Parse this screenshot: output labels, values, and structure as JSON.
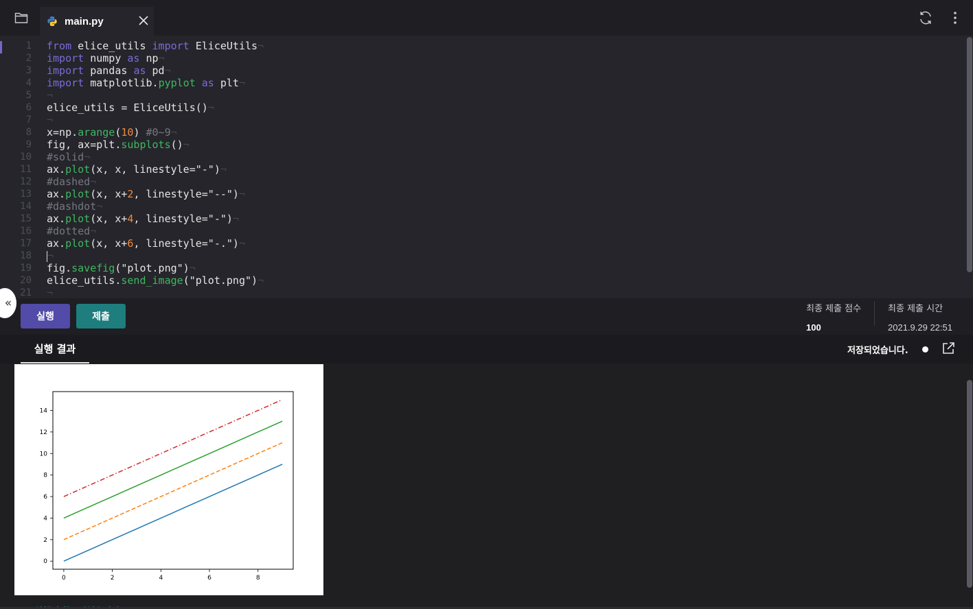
{
  "tabs": {
    "file_name": "main.py"
  },
  "icons": {
    "folder": "folder-icon",
    "python": "python-icon",
    "close": "close-icon",
    "refresh": "refresh-icon",
    "more": "more-vertical-icon",
    "collapse": "double-chevron-left-icon",
    "popout": "external-link-icon"
  },
  "editor": {
    "line_numbers": [
      "1",
      "2",
      "3",
      "4",
      "5",
      "6",
      "7",
      "8",
      "9",
      "10",
      "11",
      "12",
      "13",
      "14",
      "15",
      "16",
      "17",
      "18",
      "19",
      "20",
      "21"
    ],
    "code_lines": [
      "from elice_utils import EliceUtils",
      "import numpy as np",
      "import pandas as pd",
      "import matplotlib.pyplot as plt",
      "",
      "elice_utils = EliceUtils()",
      "",
      "x=np.arange(10) #0~9",
      "fig, ax=plt.subplots()",
      "#solid",
      "ax.plot(x, x, linestyle=\"-\")",
      "#dashed",
      "ax.plot(x, x+2, linestyle=\"--\")",
      "#dashdot",
      "ax.plot(x, x+4, linestyle=\"-\")",
      "#dotted",
      "ax.plot(x, x+6, linestyle=\"-.\")",
      "",
      "fig.savefig(\"plot.png\")",
      "elice_utils.send_image(\"plot.png\")",
      ""
    ]
  },
  "actions": {
    "run_label": "실행",
    "submit_label": "제출"
  },
  "stats": {
    "score_label": "최종 제출 점수",
    "score_value": "100",
    "time_label": "최종 제출 시간",
    "time_value": "2021.9.29 22:51"
  },
  "results": {
    "tab_label": "실행 결과",
    "saved_text": "저장되었습니다.",
    "status_text": "코드 실행이 완료되었습니다."
  },
  "colors": {
    "run_button": "#524ba8",
    "submit_button": "#1e7d7d",
    "keyword": "#7b6cd9",
    "function": "#3fb860",
    "number": "#f1893a"
  },
  "chart_data": {
    "type": "line",
    "x": [
      0,
      1,
      2,
      3,
      4,
      5,
      6,
      7,
      8,
      9
    ],
    "series": [
      {
        "values": [
          0,
          1,
          2,
          3,
          4,
          5,
          6,
          7,
          8,
          9
        ],
        "color": "#1f77b4",
        "linestyle": "solid"
      },
      {
        "values": [
          2,
          3,
          4,
          5,
          6,
          7,
          8,
          9,
          10,
          11
        ],
        "color": "#ff7f0e",
        "linestyle": "dashed"
      },
      {
        "values": [
          4,
          5,
          6,
          7,
          8,
          9,
          10,
          11,
          12,
          13
        ],
        "color": "#2ca02c",
        "linestyle": "solid"
      },
      {
        "values": [
          6,
          7,
          8,
          9,
          10,
          11,
          12,
          13,
          14,
          15
        ],
        "color": "#d62728",
        "linestyle": "dashdot"
      }
    ],
    "x_ticks": [
      "0",
      "2",
      "4",
      "6",
      "8"
    ],
    "y_ticks": [
      "0",
      "2",
      "4",
      "6",
      "8",
      "10",
      "12",
      "14"
    ],
    "xlim": [
      -0.45,
      9.45
    ],
    "ylim": [
      -0.75,
      15.75
    ],
    "grid": false
  }
}
